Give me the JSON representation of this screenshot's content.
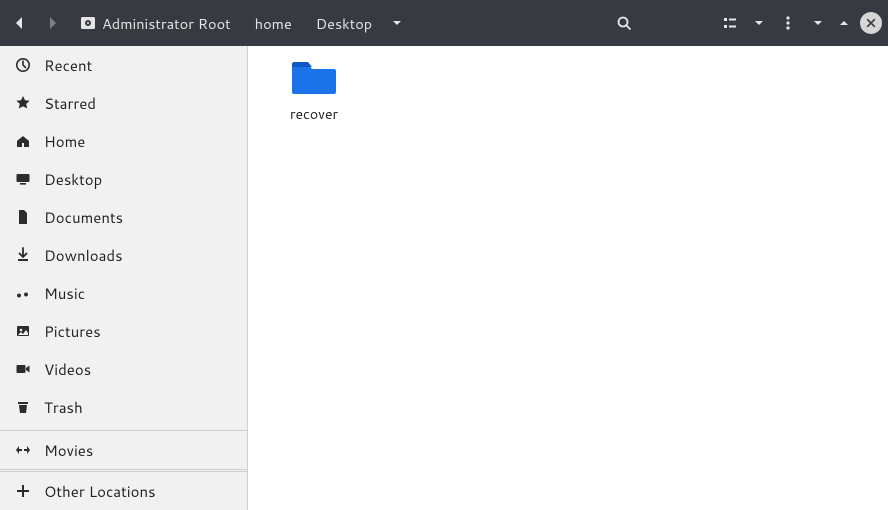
{
  "header": {
    "path": [
      {
        "label": "Administrator Root",
        "has_disk_icon": true
      },
      {
        "label": "home",
        "has_disk_icon": false
      },
      {
        "label": "Desktop",
        "has_disk_icon": false
      }
    ]
  },
  "sidebar": {
    "items": [
      {
        "icon": "clock-icon",
        "label": "Recent"
      },
      {
        "icon": "star-icon",
        "label": "Starred"
      },
      {
        "icon": "home-icon",
        "label": "Home"
      },
      {
        "icon": "desktop-icon",
        "label": "Desktop"
      },
      {
        "icon": "document-icon",
        "label": "Documents"
      },
      {
        "icon": "download-icon",
        "label": "Downloads"
      },
      {
        "icon": "music-icon",
        "label": "Music"
      },
      {
        "icon": "pictures-icon",
        "label": "Pictures"
      },
      {
        "icon": "videos-icon",
        "label": "Videos"
      },
      {
        "icon": "trash-icon",
        "label": "Trash"
      }
    ],
    "mounts": [
      {
        "icon": "arrows-icon",
        "label": "Movies"
      }
    ],
    "bottom": [
      {
        "icon": "plus-icon",
        "label": "Other Locations"
      }
    ]
  },
  "main": {
    "items": [
      {
        "kind": "folder",
        "label": "recover",
        "color": "#1a73e8"
      }
    ]
  }
}
